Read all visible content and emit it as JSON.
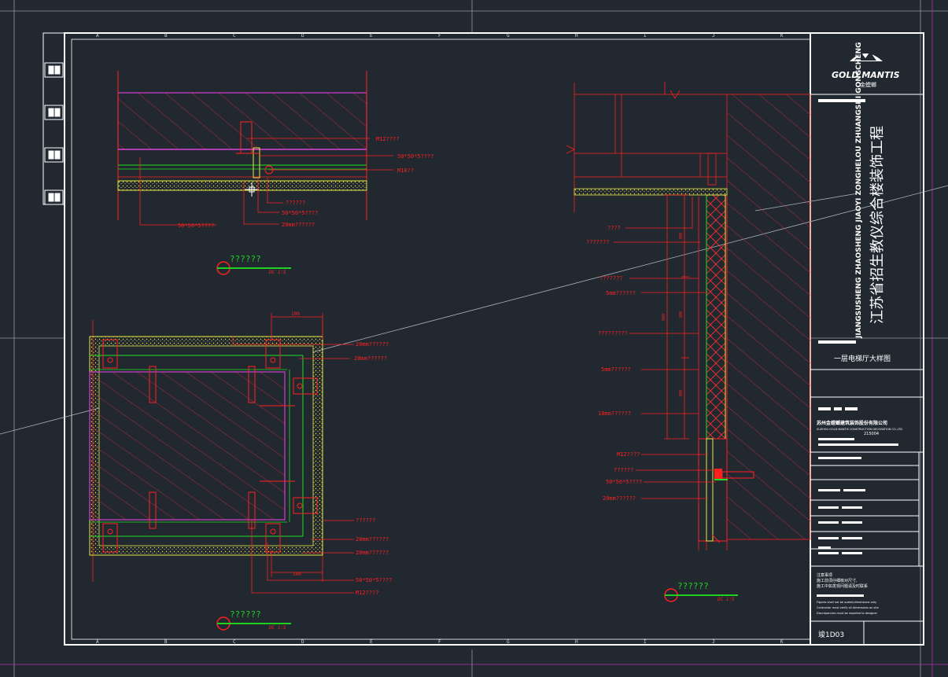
{
  "colors": {
    "background": "#212830",
    "frame": "#ffffff",
    "annotation": "#ff2020",
    "hatch": "#b52a3a",
    "slab_outline": "#d040d0",
    "finish_green": "#20e020",
    "finish_yellow": "#e8e840",
    "callout_green": "#20d020"
  },
  "detail_top": {
    "labels": [
      "M12????",
      "50*50*5????",
      "M10??",
      "??????",
      "50*50*5????",
      "20mm??????",
      "50*50*5????"
    ],
    "callout_title": "??????",
    "callout_scale": "DC 1:5"
  },
  "detail_plan": {
    "labels_top": [
      "20mm??????",
      "20mm??????"
    ],
    "labels_bottom": [
      "??????",
      "20mm??????",
      "20mm??????",
      "50*50*5????",
      "M12????"
    ],
    "dim_top": "100",
    "dim_bottom": "100",
    "callout_title": "??????",
    "callout_scale": "DC 1:5"
  },
  "detail_section": {
    "labels": [
      "????",
      "???????",
      "???????",
      "5mm??????",
      "?????????",
      "5mm??????",
      "18mm??????",
      "M12????",
      "??????",
      "50*50*5????",
      "20mm??????"
    ],
    "dims": [
      "300",
      "300",
      "300",
      "900"
    ],
    "callout_title": "??????",
    "callout_scale": "DC 1:5"
  },
  "title_block": {
    "logo_text": "GOLD MANTIS",
    "logo_sub": "金螳螂",
    "project_pinyin": "JIANGSUSHENG ZHAOSHENG JIAOYI ZONGHELOU ZHUANGSHI GONGCHENG",
    "project_name": "江苏省招生教仪综合楼装饰工程",
    "drawing_name": "一层电梯厅大样图",
    "company_cn": "苏州金螳螂建筑装饰股份有限公司",
    "company_en": "SUZHOU GOLD MANTIS CONSTRUCTION DECORATION CO.,LTD",
    "postcode": "215004",
    "notes_cn": [
      "注意事项",
      "施工前须仔细核对尺寸,",
      "施工中如发现问题请及时联系"
    ],
    "notes_en": [
      "Figures shall not be scaled,dimensions only",
      "Contractor must verify all dimensions on site",
      "Discrepancies must be reported to designer"
    ],
    "drawing_number": "竣1D03"
  },
  "frame": {
    "grid_letters": [
      "A",
      "B",
      "C",
      "D",
      "E",
      "F",
      "G",
      "H",
      "I",
      "J",
      "K"
    ]
  }
}
